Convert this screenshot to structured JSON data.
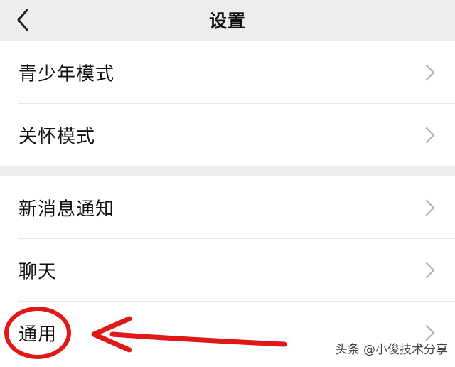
{
  "header": {
    "title": "设置",
    "back_icon": "chevron-left-icon"
  },
  "groups": [
    {
      "items": [
        {
          "label": "青少年模式"
        },
        {
          "label": "关怀模式"
        }
      ]
    },
    {
      "items": [
        {
          "label": "新消息通知"
        },
        {
          "label": "聊天"
        },
        {
          "label": "通用"
        }
      ]
    }
  ],
  "annotation": {
    "color": "#e01818",
    "highlighted_item": "通用"
  },
  "watermark": "头条 @小俊技术分享",
  "colors": {
    "background": "#ededed",
    "card": "#ffffff",
    "text": "#111111",
    "chevron": "#b2b2b2"
  }
}
